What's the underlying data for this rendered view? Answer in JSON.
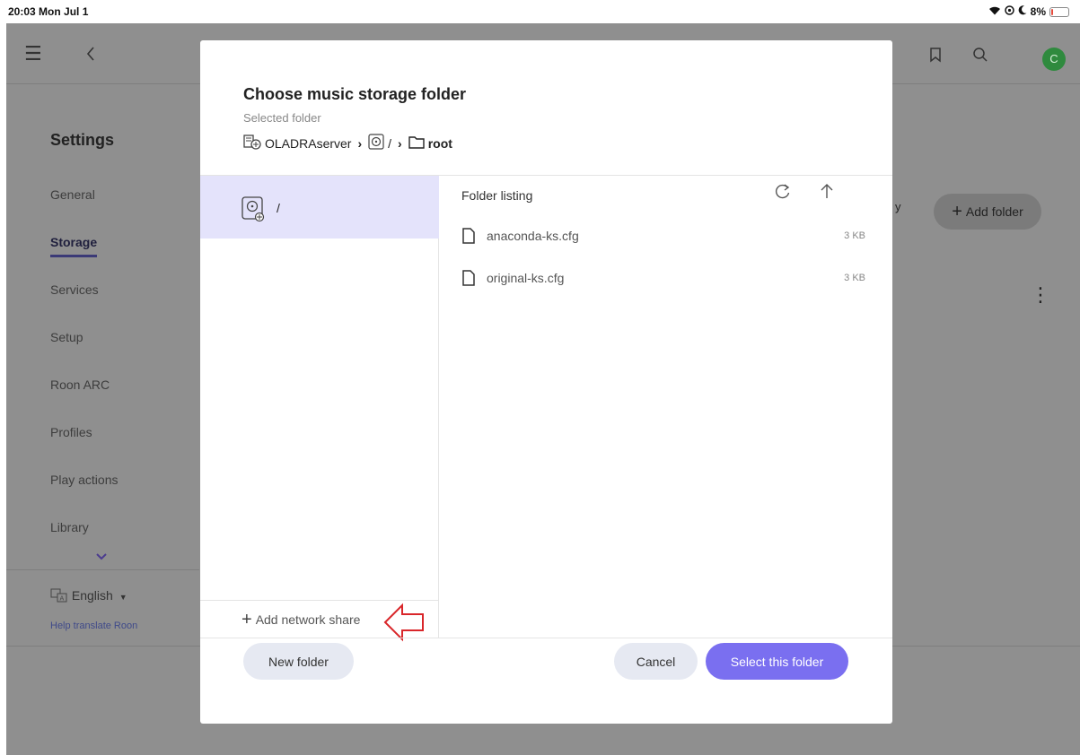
{
  "status_bar": {
    "time": "20:03  Mon Jul 1",
    "battery_text": "8%",
    "battery_level": 0.08,
    "icons": [
      "wifi-icon",
      "focus-icon",
      "moon-icon",
      "battery-icon"
    ]
  },
  "app": {
    "avatar_letter": "C",
    "settings_title": "Settings",
    "nav": [
      "General",
      "Storage",
      "Services",
      "Setup",
      "Roon ARC",
      "Profiles",
      "Play actions",
      "Library"
    ],
    "active_nav": "Storage",
    "language": "English",
    "help_translate": "Help translate Roon",
    "add_folder_label": "Add folder",
    "partial_text": "y"
  },
  "modal": {
    "title": "Choose music storage folder",
    "subtitle": "Selected folder",
    "breadcrumb": {
      "server": "OLADRAserver",
      "drive": "/",
      "folder": "root"
    },
    "left_pane": {
      "drive_label": "/",
      "add_network_share": "Add network share"
    },
    "listing": {
      "header": "Folder listing",
      "files": [
        {
          "name": "anaconda-ks.cfg",
          "size": "3 KB"
        },
        {
          "name": "original-ks.cfg",
          "size": "3 KB"
        }
      ]
    },
    "buttons": {
      "new_folder": "New folder",
      "cancel": "Cancel",
      "select": "Select this folder"
    }
  },
  "colors": {
    "accent": "#7a6ff0",
    "selected_row": "#e4e3fb",
    "avatar": "#2f8a3e",
    "annotation_arrow": "#d9262a"
  }
}
